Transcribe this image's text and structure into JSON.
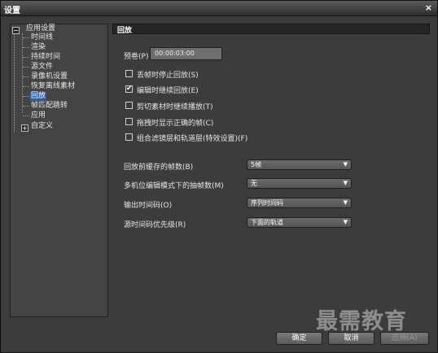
{
  "window": {
    "title": "设置",
    "close_glyph": "×"
  },
  "tree": {
    "root_label": "应用设置",
    "root_expander": "−",
    "items": [
      {
        "label": "时间线"
      },
      {
        "label": "渲染"
      },
      {
        "label": "持续时间"
      },
      {
        "label": "源文件"
      },
      {
        "label": "录像机设置"
      },
      {
        "label": "恢复离线素材"
      },
      {
        "label": "回放"
      },
      {
        "label": "帧匹配跳转"
      },
      {
        "label": "应用"
      }
    ],
    "selected_item": "回放",
    "custom_label": "自定义",
    "custom_expander": "+"
  },
  "panel": {
    "header": "回放",
    "preroll": {
      "label": "预卷(P)",
      "value": "00:00:03:00"
    },
    "checkboxes": [
      {
        "label": "丢帧时停止回放(S)",
        "checked": false
      },
      {
        "label": "编辑时继续回放(E)",
        "checked": true
      },
      {
        "label": "剪切素材时继续播放(T)",
        "checked": false
      },
      {
        "label": "拖拽时显示正确的帧(C)",
        "checked": false
      },
      {
        "label": "组合滤镜层和轨道层(特效设置)(F)",
        "checked": false
      }
    ],
    "dropdowns": [
      {
        "label": "回放前缓存的帧数(B)",
        "value": "5帧"
      },
      {
        "label": "多机位编辑模式下的抽帧数(M)",
        "value": "无"
      },
      {
        "label": "输出时间码(O)",
        "value": "序列时间码"
      },
      {
        "label": "源时间码优先级(R)",
        "value": "下面的轨道"
      }
    ]
  },
  "buttons": {
    "ok": "确定",
    "cancel": "取消",
    "apply": "应用(A)"
  },
  "watermark": "最需教育",
  "icons": {
    "check": "✔",
    "dropdown_arrow": "▼"
  }
}
